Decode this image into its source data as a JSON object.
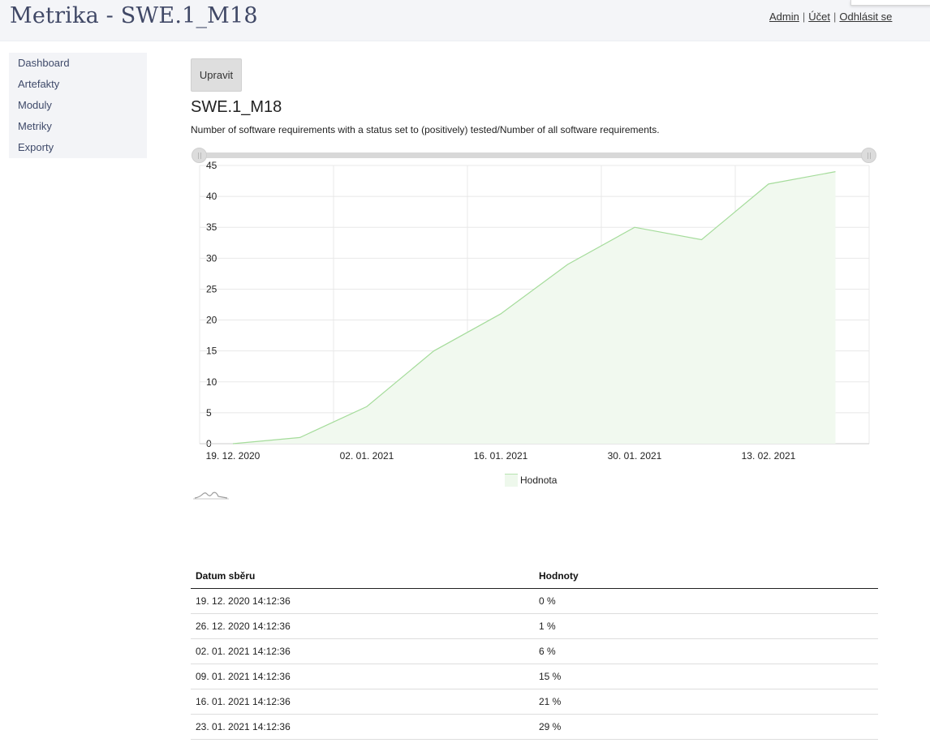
{
  "header": {
    "title": "Metrika - SWE.1_M18",
    "links": {
      "admin": "Admin",
      "account": "Účet",
      "logout": "Odhlásit se",
      "separator": "|"
    }
  },
  "sidebar": {
    "items": [
      {
        "label": "Dashboard"
      },
      {
        "label": "Artefakty"
      },
      {
        "label": "Moduly"
      },
      {
        "label": "Metriky"
      },
      {
        "label": "Exporty"
      }
    ]
  },
  "main": {
    "edit_button": "Upravit",
    "metric_title": "SWE.1_M18",
    "description": "Number of software requirements with a status set to (positively) tested/Number of all software requirements."
  },
  "chart_data": {
    "type": "area",
    "x": [
      "2020-12-19",
      "2020-12-26",
      "2021-01-02",
      "2021-01-09",
      "2021-01-16",
      "2021-01-23",
      "2021-01-30",
      "2021-02-06",
      "2021-02-13",
      "2021-02-20"
    ],
    "series": [
      {
        "name": "Hodnota",
        "values": [
          0,
          1,
          6,
          15,
          21,
          29,
          35,
          33,
          42,
          44
        ]
      }
    ],
    "x_ticks": [
      "19. 12. 2020",
      "02. 01. 2021",
      "16. 01. 2021",
      "30. 01. 2021",
      "13. 02. 2021"
    ],
    "y_ticks": [
      0,
      5,
      10,
      15,
      20,
      25,
      30,
      35,
      40,
      45
    ],
    "ylim": [
      0,
      45
    ],
    "xlim": [
      "2020-12-19",
      "2021-02-27"
    ],
    "grid": true,
    "legend": "bottom-center",
    "line_color": "#a5dc9b",
    "fill_color": "#f1f9ef",
    "grid_color": "#e8e8e8"
  },
  "table": {
    "headers": [
      "Datum sběru",
      "Hodnoty"
    ],
    "rows": [
      [
        "19. 12. 2020 14:12:36",
        "0 %"
      ],
      [
        "26. 12. 2020 14:12:36",
        "1 %"
      ],
      [
        "02. 01. 2021 14:12:36",
        "6 %"
      ],
      [
        "09. 01. 2021 14:12:36",
        "15 %"
      ],
      [
        "16. 01. 2021 14:12:36",
        "21 %"
      ],
      [
        "23. 01. 2021 14:12:36",
        "29 %"
      ]
    ]
  },
  "icons": {
    "range_selector": "sparkline-icon",
    "slider_handle": "slider-grip-icon"
  }
}
